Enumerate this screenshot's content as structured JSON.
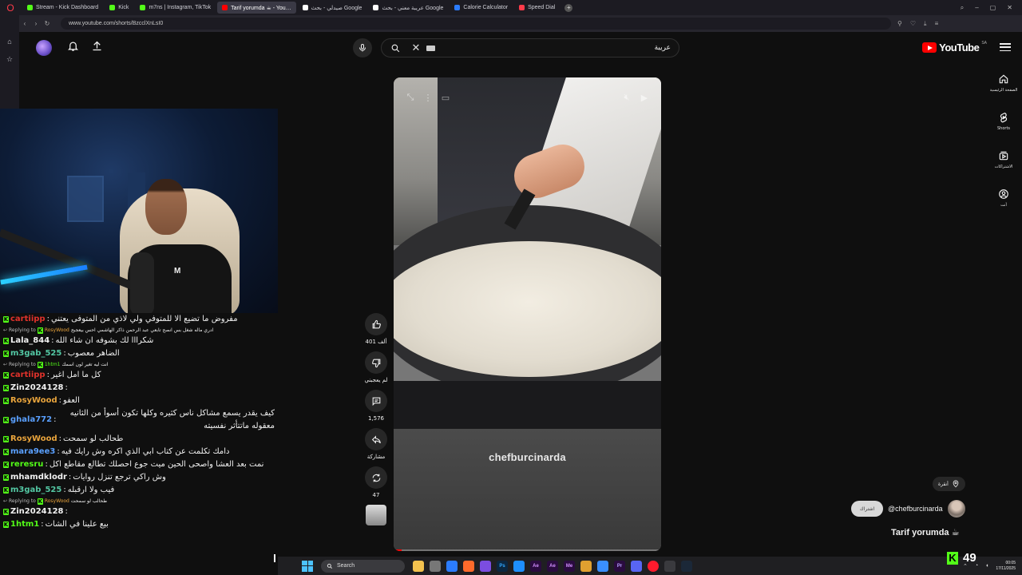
{
  "browser": {
    "tabs": [
      {
        "label": "Stream - Kick Dashboard",
        "color": "#53fc18",
        "active": false
      },
      {
        "label": "Kick",
        "color": "#53fc18",
        "active": false
      },
      {
        "label": "m7ns | Instagram, TikTok",
        "color": "#53fc18",
        "active": false
      },
      {
        "label": "Tarif yorumda ☕ - You…",
        "color": "#ff0000",
        "active": true
      },
      {
        "label": "صيدلي - بحث Google",
        "color": "#ffffff",
        "active": false
      },
      {
        "label": "عريبة معني - بحث Google",
        "color": "#ffffff",
        "active": false
      },
      {
        "label": "Calorie Calculator",
        "color": "#2b7cff",
        "active": false
      },
      {
        "label": "Speed Dial",
        "color": "#ff3b4a",
        "active": false
      }
    ],
    "url": "www.youtube.com/shorts/BzcclXnLsI0"
  },
  "header": {
    "search_value": "عريبة",
    "logo_text": "YouTube",
    "region": "SA"
  },
  "guide": [
    {
      "label": "الصفحة الرئيسية",
      "icon": "home-icon"
    },
    {
      "label": "Shorts",
      "icon": "shorts-icon"
    },
    {
      "label": "الاشتراكات",
      "icon": "subscriptions-icon"
    },
    {
      "label": "أنت",
      "icon": "you-icon"
    }
  ],
  "chat": {
    "messages": [
      {
        "type": "line",
        "user": "cartiipp",
        "color": "#e0322b",
        "text": "مفروض ما تضيع الا للمتوفي ولي لاذي من المتوفى يعتني"
      },
      {
        "type": "reply",
        "to": "RosyWood",
        "to_color": "#e9a43c",
        "text": "ادري ماله شغل بس انصح تابعي عبد الرحمن ذاكر الهاشمي احس بيعجبج"
      },
      {
        "type": "line",
        "user": "Lala_844",
        "color": "#f1f1f1",
        "text": "شكرااا لك بشوفه ان شاء الله"
      },
      {
        "type": "line",
        "user": "m3gab_525",
        "color": "#53c7a3",
        "text": "الضاهر معصوب"
      },
      {
        "type": "reply",
        "to": "1htm1",
        "to_color": "#53fc18",
        "text": "انت ليه تغير لون اسمك"
      },
      {
        "type": "line",
        "user": "cartiipp",
        "color": "#e0322b",
        "text": "كل ما امل اغير"
      },
      {
        "type": "line",
        "user": "Zin2024128",
        "color": "#f1f1f1",
        "text": ""
      },
      {
        "type": "line",
        "user": "RosyWood",
        "color": "#e9a43c",
        "text": "العفو"
      },
      {
        "type": "line",
        "user": "ghala772",
        "color": "#5aa0ff",
        "text": "كيف يقدر يسمع مشاكل ناس كثيره وكلها تكون أسوأ من الثانيه معقوله ماتتأثر نفسيته"
      },
      {
        "type": "line",
        "user": "RosyWood",
        "color": "#e9a43c",
        "text": "طحالب لو سمحت"
      },
      {
        "type": "line",
        "user": "mara9ee3",
        "color": "#5aa0ff",
        "text": "دامك تكلمت عن كتاب ابي الذي اكره وش رايك فيه"
      },
      {
        "type": "line",
        "user": "reresru",
        "color": "#53fc18",
        "text": "نمت بعد العشا واصحى الحين ميت جوع احصلك تطالع مقاطع اكل"
      },
      {
        "type": "line",
        "user": "mhamdklodr",
        "color": "#f1f1f1",
        "text": "وش راكي ترجع تنزل روايات"
      },
      {
        "type": "line",
        "user": "m3gab_525",
        "color": "#53c7a3",
        "text": "فيب ولا ارقبله"
      },
      {
        "type": "reply",
        "to": "RosyWood",
        "to_color": "#e9a43c",
        "text": "طحالب لو سمحت"
      },
      {
        "type": "line",
        "user": "Zin2024128",
        "color": "#f1f1f1",
        "text": ""
      },
      {
        "type": "line",
        "user": "1htm1",
        "color": "#53fc18",
        "text": "بيع علينا في الشات"
      }
    ],
    "replying_label": "Replying to"
  },
  "player": {
    "watermark": "chefburcinarda",
    "progress": 0.03
  },
  "actions": {
    "likes": "401 ألف",
    "dislike_label": "لم يعجبني",
    "comments": "1,576",
    "share_label": "مشاركة",
    "remix_count": "47"
  },
  "channel": {
    "location": "أنقرة",
    "handle": "@chefburcinarda",
    "subscribe_label": "اشتراك",
    "video_title": "Tarif yorumda ☕"
  },
  "taskbar": {
    "search_placeholder": "Search",
    "time": "00:05",
    "date": "17/11/2025"
  },
  "viewers": {
    "count": "49"
  }
}
